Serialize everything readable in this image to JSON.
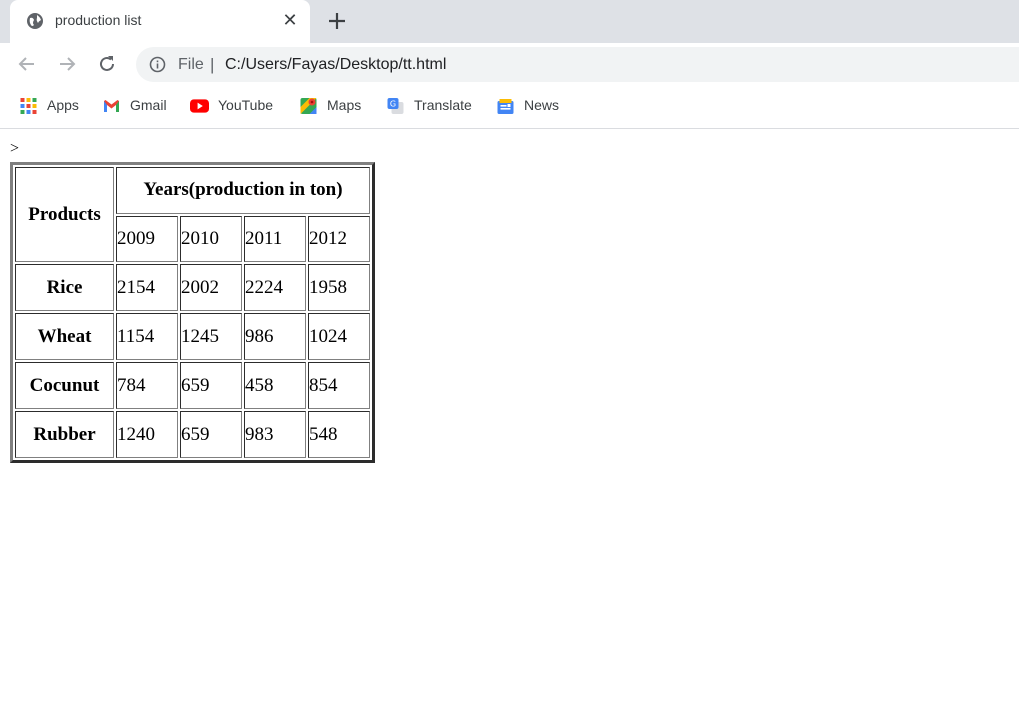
{
  "browser": {
    "tab": {
      "title": "production list",
      "close_glyph": "✕",
      "icon": "globe-icon"
    },
    "new_tab_icon": "plus-icon",
    "toolbar": {
      "back_icon": "back-arrow-icon",
      "forward_icon": "forward-arrow-icon",
      "reload_icon": "reload-icon",
      "info_icon": "info-icon",
      "scheme": "File",
      "separator": "|",
      "url": "C:/Users/Fayas/Desktop/tt.html"
    },
    "bookmarks": [
      {
        "label": "Apps",
        "icon": "apps-grid-icon"
      },
      {
        "label": "Gmail",
        "icon": "gmail-icon"
      },
      {
        "label": "YouTube",
        "icon": "youtube-icon"
      },
      {
        "label": "Maps",
        "icon": "maps-icon"
      },
      {
        "label": "Translate",
        "icon": "translate-icon"
      },
      {
        "label": "News",
        "icon": "news-icon"
      }
    ]
  },
  "page": {
    "stray_text": ">",
    "table": {
      "corner_header": "Products",
      "group_header": "Years(production in ton)",
      "years": [
        "2009",
        "2010",
        "2011",
        "2012"
      ],
      "rows": [
        {
          "product": "Rice",
          "values": [
            "2154",
            "2002",
            "2224",
            "1958"
          ]
        },
        {
          "product": "Wheat",
          "values": [
            "1154",
            "1245",
            "986",
            "1024"
          ]
        },
        {
          "product": "Cocunut",
          "values": [
            "784",
            "659",
            "458",
            "854"
          ]
        },
        {
          "product": "Rubber",
          "values": [
            "1240",
            "659",
            "983",
            "548"
          ]
        }
      ]
    }
  }
}
